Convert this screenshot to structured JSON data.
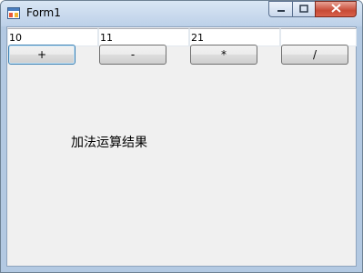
{
  "window": {
    "title": "Form1"
  },
  "inputs": [
    {
      "value": "10"
    },
    {
      "value": "11"
    },
    {
      "value": "21"
    },
    {
      "value": ""
    }
  ],
  "buttons": [
    {
      "label": "+"
    },
    {
      "label": "-"
    },
    {
      "label": "*"
    },
    {
      "label": "/"
    }
  ],
  "result_label": "加法运算结果",
  "icons": {
    "app": "app-window-icon",
    "minimize": "minimize-icon",
    "maximize": "maximize-icon",
    "close": "close-icon"
  },
  "colors": {
    "client_background": "#f0f0f0",
    "close_button": "#c74a35"
  }
}
